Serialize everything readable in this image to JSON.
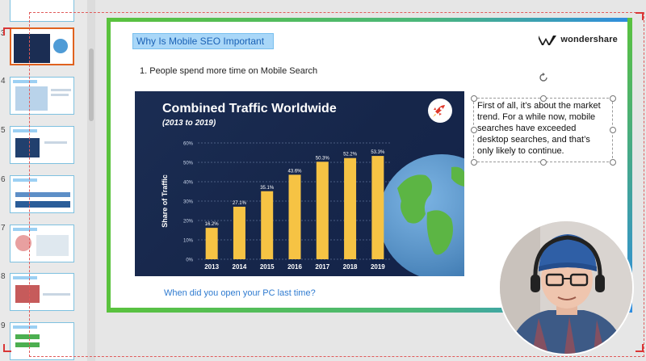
{
  "thumbnails": {
    "numbers": [
      "3",
      "4",
      "5",
      "6",
      "7",
      "8",
      "9"
    ]
  },
  "slide": {
    "title": "Why Is Mobile SEO Important",
    "logo_text": "wondershare",
    "point_1": "1. People spend more time on Mobile Search",
    "question": "When did you open your PC last time?",
    "textbox_text": "First of all, it’s about the market trend. For a while now, mobile searches have exceeded desktop searches, and that’s only likely to continue."
  },
  "chart_data": {
    "type": "bar",
    "title": "Combined Traffic Worldwide",
    "subtitle": "(2013 to 2019)",
    "ylabel": "Share of Traffic",
    "categories": [
      "2013",
      "2014",
      "2015",
      "2016",
      "2017",
      "2018",
      "2019"
    ],
    "values": [
      16.2,
      27.1,
      35.1,
      43.6,
      50.3,
      52.2,
      53.3
    ],
    "value_labels": [
      "16.2%",
      "27.1%",
      "35.1%",
      "43.6%",
      "50.3%",
      "52.2%",
      "53.3%"
    ],
    "yticks": [
      "0%",
      "10%",
      "20%",
      "30%",
      "40%",
      "50%",
      "60%"
    ],
    "ylim": [
      0,
      60
    ],
    "bar_color": "#f6c344",
    "background": "#1b2d53",
    "grid": true
  },
  "colors": {
    "accent_blue": "#2f7bd0",
    "frame_green": "#5ac23d",
    "title_fill": "#a9d7f8",
    "selection_red": "#d93636"
  },
  "icons": {
    "logo": "wondershare-logo-icon",
    "rocket": "rocket-icon",
    "globe": "globe-icon",
    "rotate": "rotate-handle-icon"
  }
}
